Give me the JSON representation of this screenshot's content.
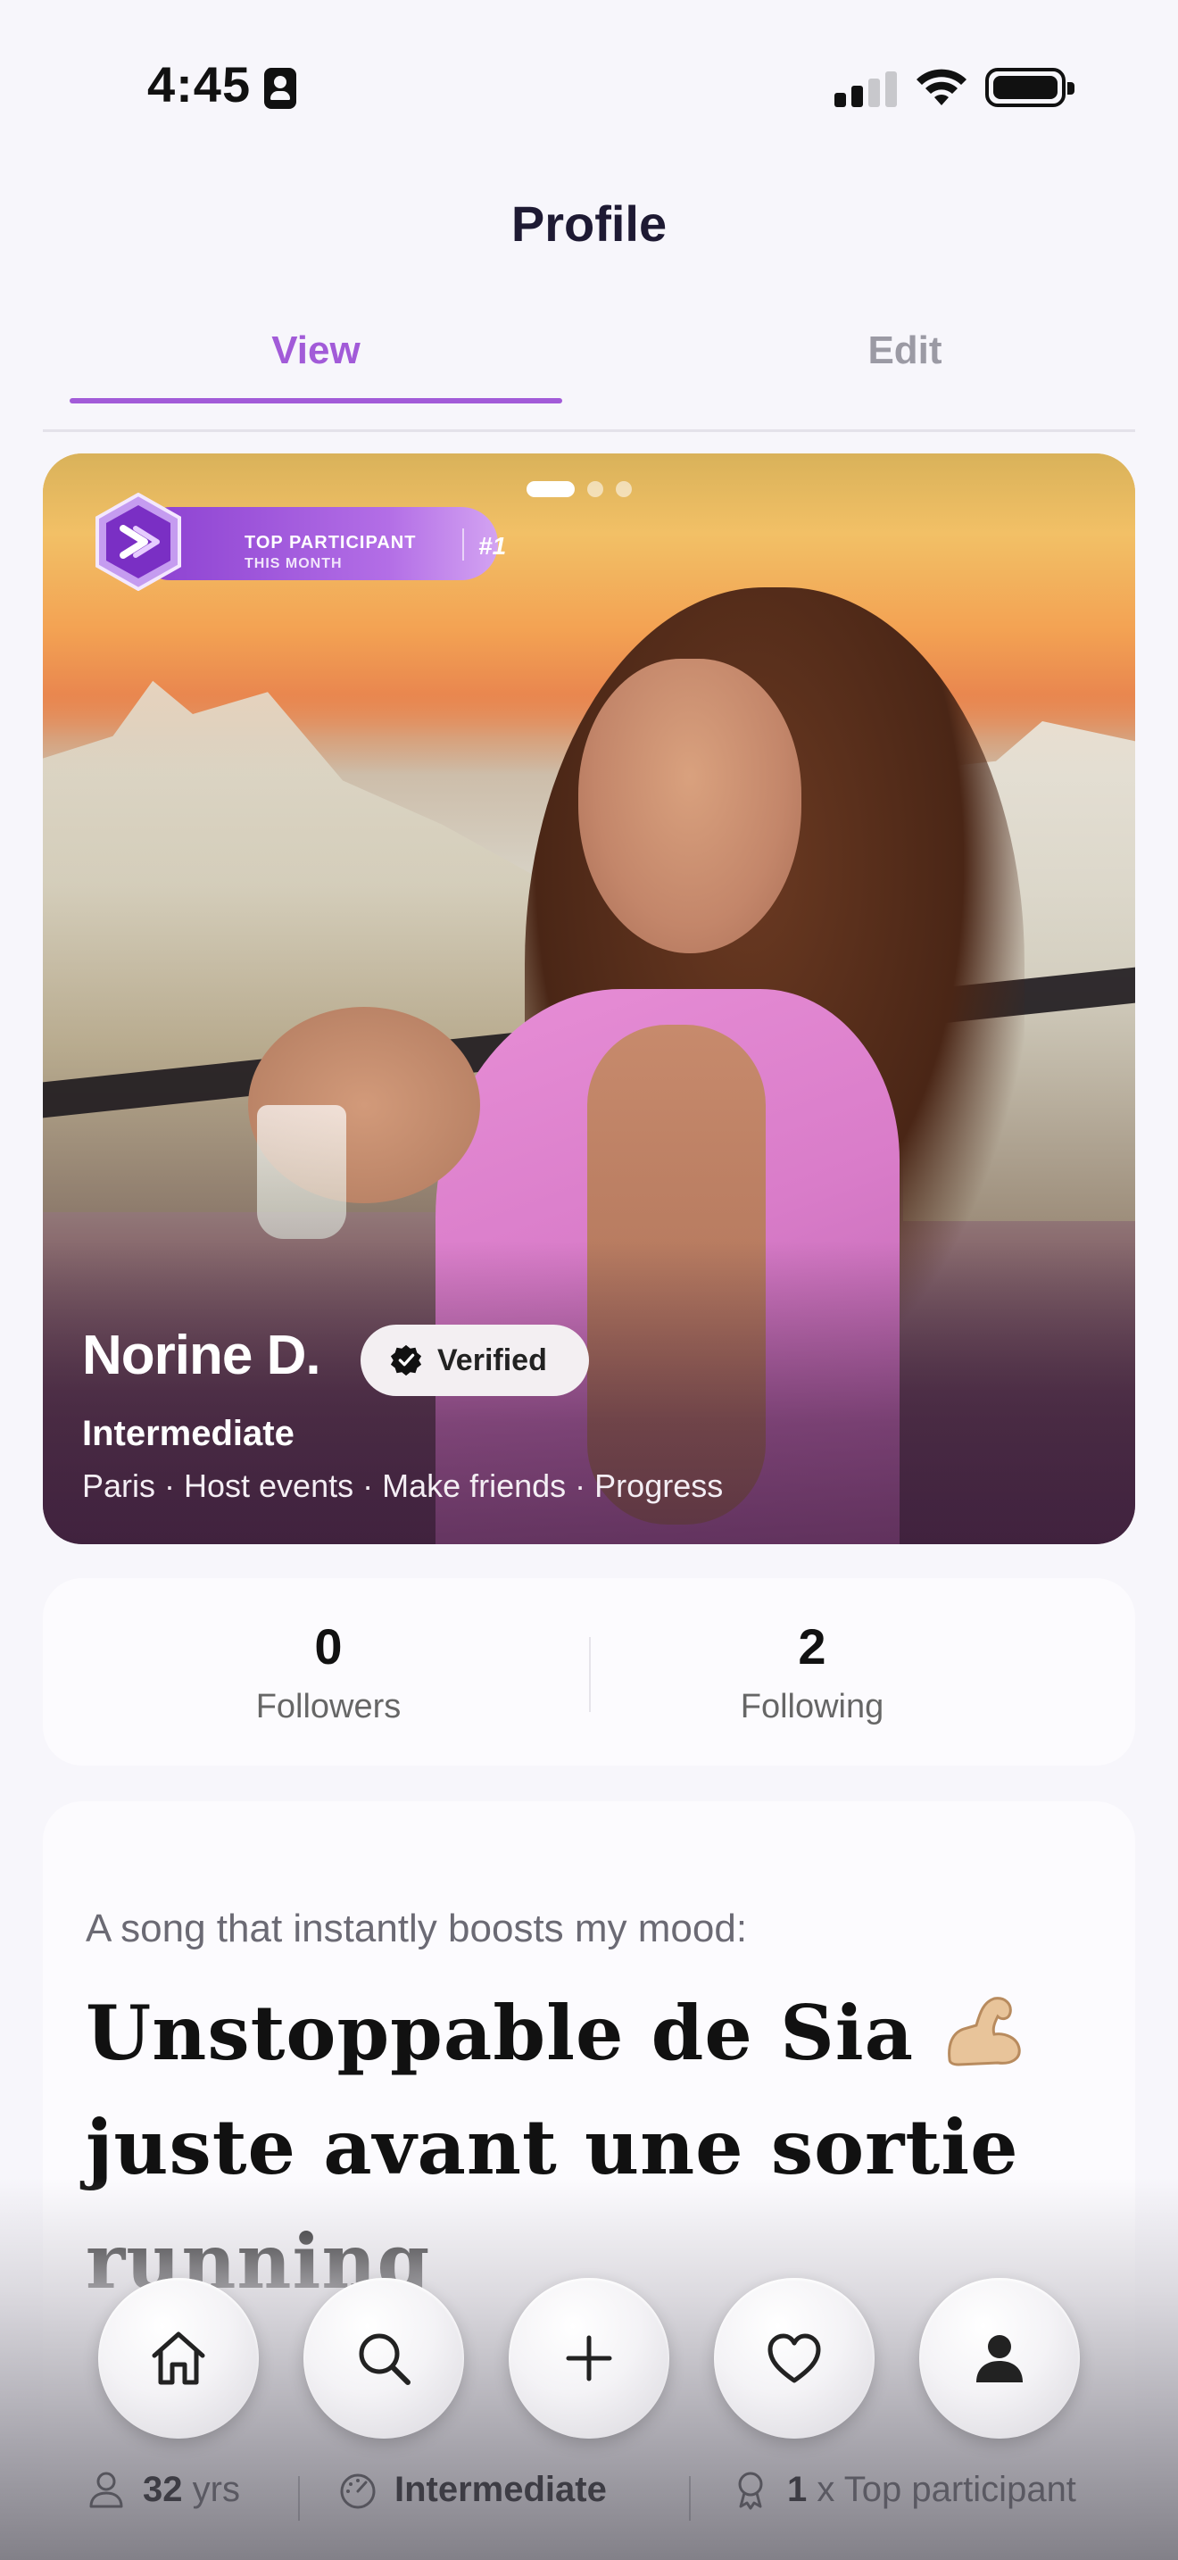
{
  "status_bar": {
    "time": "4:45"
  },
  "header": {
    "title": "Profile"
  },
  "tabs": [
    {
      "label": "View",
      "active": true
    },
    {
      "label": "Edit",
      "active": false
    }
  ],
  "photo_card": {
    "carousel": {
      "count": 3,
      "active_index": 0
    },
    "badge": {
      "title": "TOP PARTICIPANT",
      "subtitle": "THIS MONTH",
      "rank": "#1"
    },
    "name": "Norine D.",
    "verified_label": "Verified",
    "level": "Intermediate",
    "tags": "Paris · Host events · Make friends · Progress"
  },
  "stats": {
    "followers": {
      "value": "0",
      "label": "Followers"
    },
    "following": {
      "value": "2",
      "label": "Following"
    }
  },
  "prompt": {
    "question": "A song that instantly boosts my mood:",
    "answer": "Unstoppable de Sia",
    "answer_rest": "juste avant une sortie running"
  },
  "tabbar": [
    {
      "icon": "home-icon"
    },
    {
      "icon": "search-icon"
    },
    {
      "icon": "plus-icon"
    },
    {
      "icon": "heart-icon"
    },
    {
      "icon": "profile-icon"
    }
  ],
  "info_strip": {
    "age_value": "32",
    "age_unit": "yrs",
    "level": "Intermediate",
    "award_count": "1",
    "award_label": "x Top participant"
  },
  "colors": {
    "accent": "#a25bd8",
    "background": "#f7f6fb",
    "card": "#fcfbfe"
  }
}
